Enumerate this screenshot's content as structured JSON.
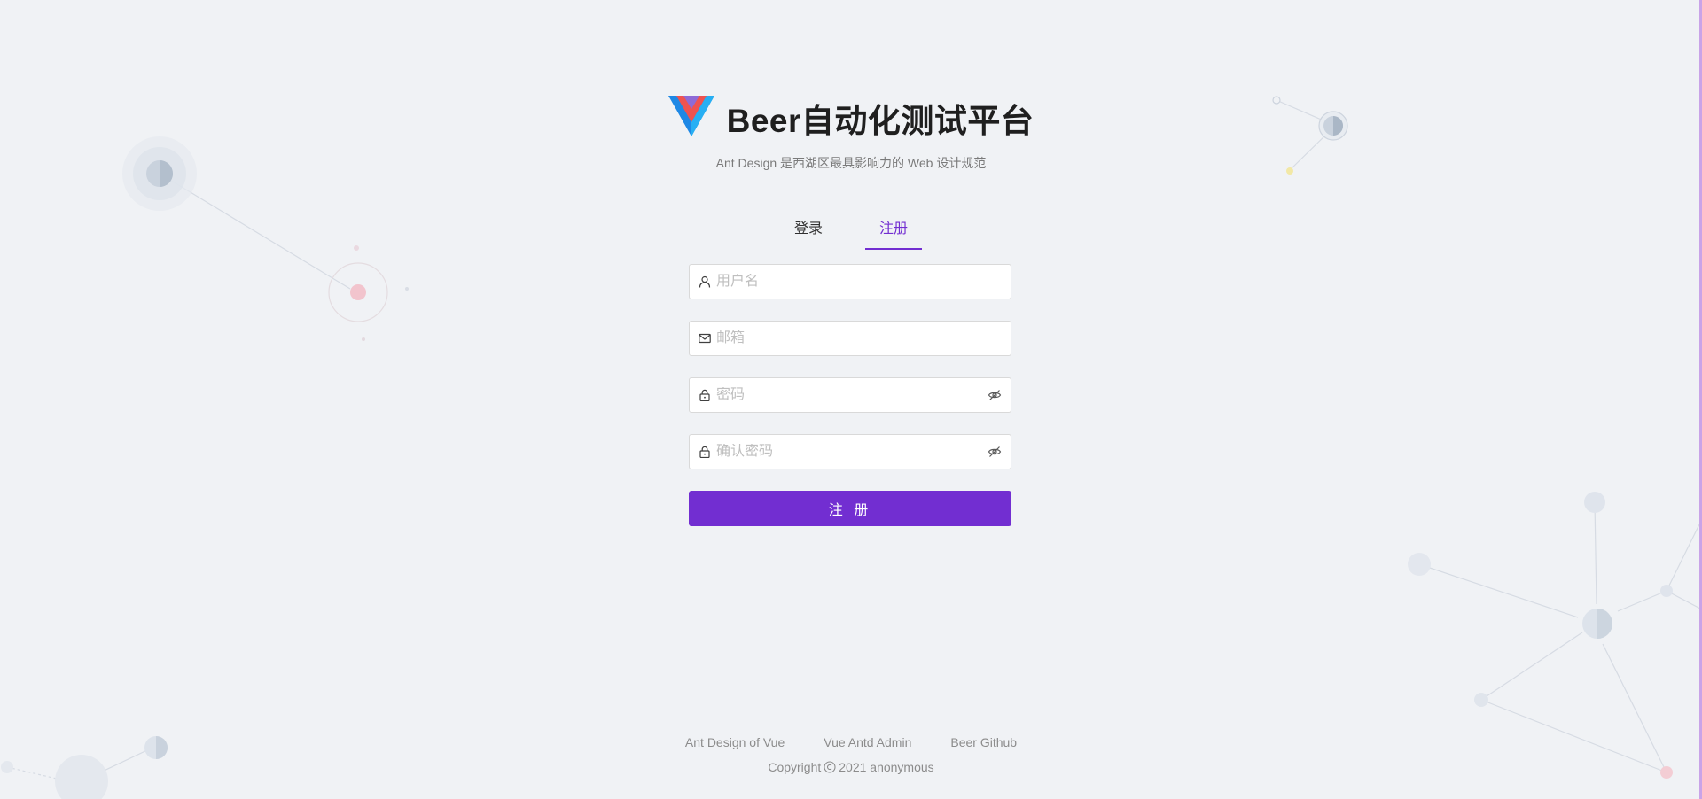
{
  "header": {
    "title": "Beer自动化测试平台",
    "subtitle": "Ant Design 是西湖区最具影响力的 Web 设计规范",
    "logo": "vue-logo"
  },
  "tabs": [
    {
      "label": "登录",
      "active": false
    },
    {
      "label": "注册",
      "active": true
    }
  ],
  "form": {
    "username": {
      "placeholder": "用户名",
      "icon": "user-icon"
    },
    "email": {
      "placeholder": "邮箱",
      "icon": "mail-icon"
    },
    "password": {
      "placeholder": "密码",
      "icon": "lock-icon",
      "suffix_icon": "eye-invisible-icon"
    },
    "confirm_password": {
      "placeholder": "确认密码",
      "icon": "lock-icon",
      "suffix_icon": "eye-invisible-icon"
    },
    "submit_label": "注 册"
  },
  "footer": {
    "links": [
      "Ant Design of Vue",
      "Vue Antd Admin",
      "Beer Github"
    ],
    "copyright_prefix": "Copyright",
    "copyright_text": "2021 anonymous"
  },
  "colors": {
    "accent": "#722ed1",
    "background": "#f0f2f5"
  }
}
